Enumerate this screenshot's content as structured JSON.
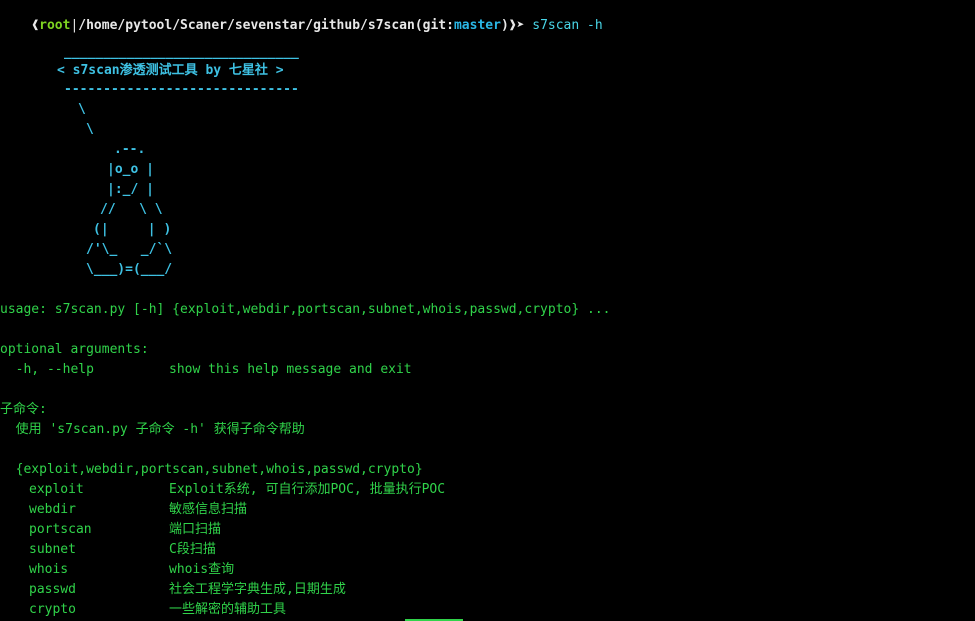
{
  "prompt": {
    "open_bracket": "❰",
    "user": "root",
    "separator": "|",
    "path": "/home/pytool/Scaner/sevenstar/github/s7scan",
    "git_open": "(git:",
    "branch": "master",
    "git_close": ")",
    "close_bracket": "❱",
    "arrow": "➤",
    "command": " s7scan -h"
  },
  "banner": {
    "top_rule": "______________________________",
    "title": "< s7scan渗透测试工具 by 七星社 >",
    "bottom_rule": "------------------------------"
  },
  "ascii_art": [
    "\\",
    "\\",
    ".--.",
    "|o_o |",
    "|:_/ |",
    "//   \\ \\",
    "(|     | )",
    "/'\\_   _/`\\",
    "\\___)=(___/"
  ],
  "help": {
    "usage": "usage: s7scan.py [-h] {exploit,webdir,portscan,subnet,whois,passwd,crypto} ...",
    "optional_header": "optional arguments:",
    "help_flag": "  -h, --help",
    "help_desc": "show this help message and exit",
    "subcommand_header": "子命令:",
    "subcommand_usage": "  使用 's7scan.py 子命令 -h' 获得子命令帮助",
    "choices": "  {exploit,webdir,portscan,subnet,whois,passwd,crypto}",
    "commands": [
      {
        "name": "exploit",
        "desc": "Exploit系统, 可自行添加POC, 批量执行POC"
      },
      {
        "name": "webdir",
        "desc": "敏感信息扫描"
      },
      {
        "name": "portscan",
        "desc": "端口扫描"
      },
      {
        "name": "subnet",
        "desc": "C段扫描"
      },
      {
        "name": "whois",
        "desc": "whois查询"
      },
      {
        "name": "passwd",
        "desc": "社会工程学字典生成,日期生成"
      },
      {
        "name": "crypto",
        "desc": "一些解密的辅助工具"
      }
    ]
  },
  "colors": {
    "background": "#000000",
    "prompt_user": "#7ed321",
    "branch": "#2ab7e6",
    "banner": "#3ec1e3",
    "output": "#30d34a"
  }
}
